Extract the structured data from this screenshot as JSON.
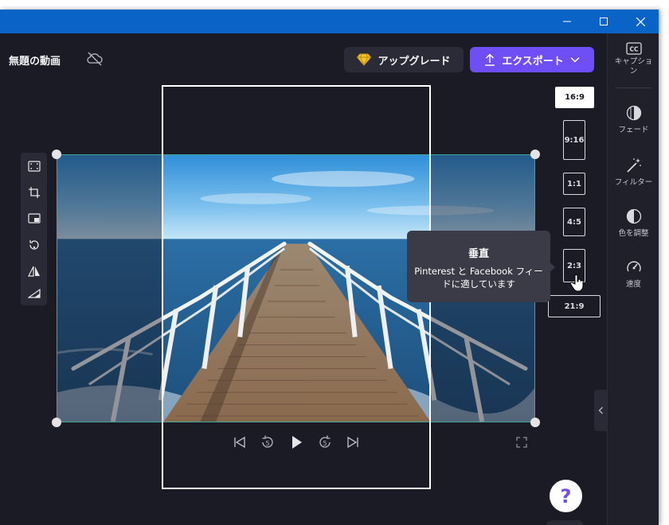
{
  "project": {
    "title": "無題の動画"
  },
  "header": {
    "upgrade_label": "アップグレード",
    "export_label": "エクスポート"
  },
  "aspect_ratios": [
    {
      "label": "16:9",
      "active": true
    },
    {
      "label": "9:16",
      "active": false
    },
    {
      "label": "1:1",
      "active": false
    },
    {
      "label": "4:5",
      "active": false
    },
    {
      "label": "2:3",
      "active": false,
      "hovered": true
    },
    {
      "label": "21:9",
      "active": false
    }
  ],
  "tooltip": {
    "title": "垂直",
    "body": "Pinterest と Facebook フィードに適しています"
  },
  "sidebar": {
    "items": [
      {
        "label": "キャプション",
        "icon": "cc-icon"
      },
      {
        "label": "フェード",
        "icon": "fade-icon"
      },
      {
        "label": "フィルター",
        "icon": "magic-wand-icon"
      },
      {
        "label": "色を調整",
        "icon": "contrast-icon"
      },
      {
        "label": "速度",
        "icon": "speedometer-icon"
      }
    ]
  },
  "help": {
    "label": "?"
  },
  "colors": {
    "accent": "#6e4ff5",
    "titlebar": "#0a64c8",
    "canvas": "#1b1b26",
    "crop_border": "#3ca89a"
  }
}
